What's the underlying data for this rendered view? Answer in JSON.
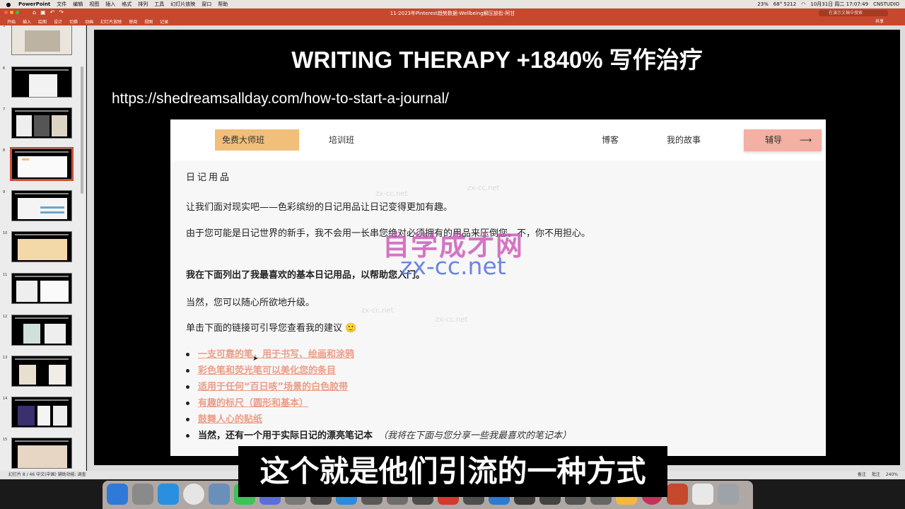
{
  "menubar": {
    "app_name": "PowerPoint",
    "items": [
      "文件",
      "编辑",
      "视图",
      "插入",
      "格式",
      "排列",
      "工具",
      "幻灯片放映",
      "窗口",
      "帮助"
    ],
    "tray": [
      "23%",
      "68° 5212",
      "10月31日 周二 17:07:49",
      "CNSTUDIO"
    ]
  },
  "toolbar": {
    "document_title": "11-2023年Pinterest趋势数据-Wellbeing解压放松-阿甘",
    "search_placeholder": "在演示文稿中搜索",
    "share_label": "共享",
    "tabs": [
      "开始",
      "插入",
      "绘图",
      "设计",
      "切换",
      "动画",
      "幻灯片放映",
      "审阅",
      "视图",
      "记录"
    ]
  },
  "sidebar": {
    "slides": [
      {
        "number": "5",
        "thumb_title": "NOW PROCESSING"
      },
      {
        "number": "6",
        "thumb_title": "NOW PROCESSING"
      },
      {
        "number": "7",
        "thumb_title": "NOW PROCESSING"
      },
      {
        "number": "8",
        "thumb_title": "WRITING THERAPY +1840% 写作治疗",
        "selected": true
      },
      {
        "number": "9",
        "thumb_title": "WRITING THERAPY +1840% 写作治疗"
      },
      {
        "number": "10",
        "thumb_title": "WRITING THERAPY +1840% 写作治疗"
      },
      {
        "number": "11",
        "thumb_title": "WRITING THERAPY +1840% 写作治疗"
      },
      {
        "number": "12",
        "thumb_title": "EXPRESSIVE ART THERAPY ACTIVITIES +130% 表达性艺术治疗"
      },
      {
        "number": "13",
        "thumb_title": "EXPRESSIVE ART THERAPY ACTIVITIES +130% 表达性艺术治疗"
      },
      {
        "number": "14",
        "thumb_title": "EXPRESSIVE ART THERAPY ACTIVITIES +130% 表达性艺术治疗"
      },
      {
        "number": "15",
        "thumb_title": "EXPRESSIVE ART THERAPY ACTIVITIES +130% 表达性艺术治疗"
      }
    ]
  },
  "slide": {
    "title": "WRITING THERAPY +1840% 写作治疗",
    "url": "https://shedreamsallday.com/how-to-start-a-journal/"
  },
  "webpage": {
    "nav": {
      "free_masterclass": "免费大师班",
      "training": "培训班",
      "blog": "博客",
      "my_story": "我的故事",
      "coaching": "辅导",
      "arrow": "⟶"
    },
    "heading": "日记用品",
    "paragraphs": [
      "让我们面对现实吧——色彩缤纷的日记用品让日记变得更加有趣。",
      "由于您可能是日记世界的新手，我不会用一长串您绝对必须拥有的用品来压倒您。不，你不用担心。",
      "我在下面列出了我最喜欢的基本日记用品，以帮助您入门。",
      "当然，您可以随心所欲地升级。",
      "单击下面的链接可引导您查看我的建议 🙂"
    ],
    "list_items": [
      "一支可靠的笔，用于书写、绘画和涂鸦",
      "彩色笔和荧光笔可以美化您的条目",
      "适用于任何“百日咳”场景的白色胶带",
      "有趣的标尺（圆形和基本）",
      "鼓舞人心的贴纸"
    ],
    "last_item": "当然，还有一个用于实际日记的漂亮笔记本",
    "last_item_note": "（我将在下面与您分享一些我最喜欢的笔记本）"
  },
  "watermark": {
    "cn": "自学成才网",
    "domain": "zx-cc.net",
    "small": "zx-cc.net"
  },
  "statusbar": {
    "left": "幻灯片 8 / 46   中文(中国)   辅助功能: 调查",
    "right": [
      "备注",
      "批注",
      "240%"
    ]
  },
  "subtitle": "这个就是他们引流的一种方式",
  "colors": {
    "ribbon": "#c6482d",
    "link": "#ec9d87",
    "nav_free": "#f1bf7a",
    "nav_coach": "#f4b0a2"
  }
}
